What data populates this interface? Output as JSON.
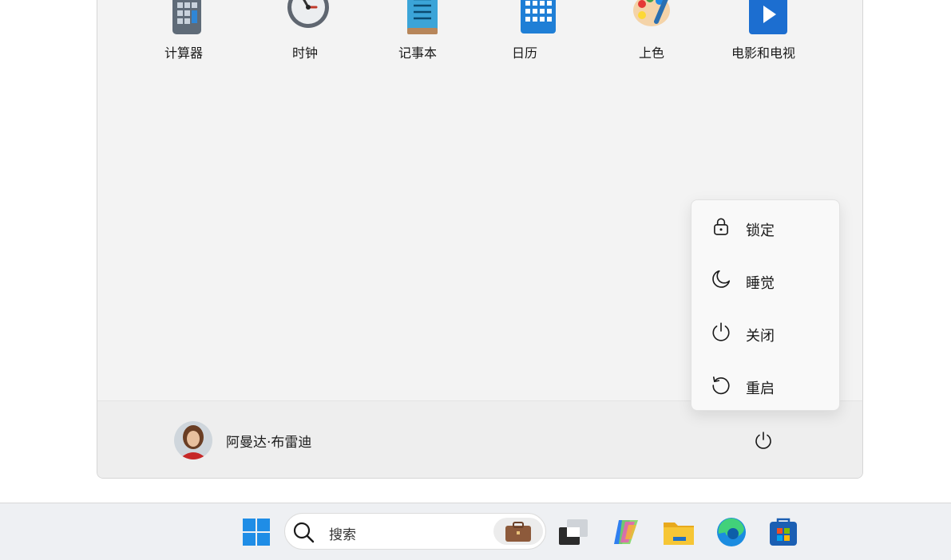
{
  "apps": [
    {
      "label": "计算器",
      "icon": "calculator-icon"
    },
    {
      "label": "时钟",
      "icon": "clock-icon"
    },
    {
      "label": "记事本",
      "icon": "notepad-icon"
    },
    {
      "label": "日历",
      "icon": "calendar-icon"
    },
    {
      "label": "上色",
      "icon": "paint-icon"
    },
    {
      "label": "电影和电视",
      "icon": "movies-tv-icon"
    }
  ],
  "user": {
    "name": "阿曼达·布雷迪",
    "avatar_icon": "avatar-photo"
  },
  "power_menu": {
    "items": [
      {
        "label": "锁定",
        "icon": "lock-icon"
      },
      {
        "label": "睡觉",
        "icon": "moon-icon"
      },
      {
        "label": "关闭",
        "icon": "power-icon"
      },
      {
        "label": "重启",
        "icon": "restart-icon"
      }
    ]
  },
  "taskbar": {
    "search_placeholder": "搜索",
    "items": [
      "start-icon",
      "search-icon",
      "work-briefcase-icon",
      "task-view-icon",
      "copilot-icon",
      "file-explorer-icon",
      "edge-icon",
      "store-icon"
    ]
  },
  "colors": {
    "accent": "#0078d4",
    "panel_bg": "#f3f3f3",
    "taskbar_bg": "#eef0f3"
  }
}
